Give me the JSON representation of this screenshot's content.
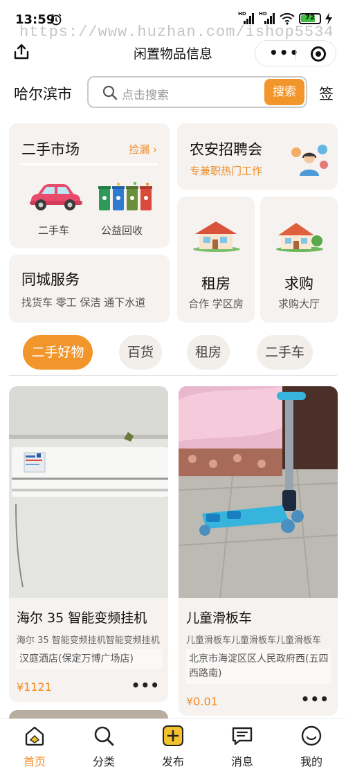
{
  "status_bar": {
    "time": "13:59",
    "battery": "72",
    "icons": [
      "alarm-icon",
      "signal-icon",
      "signal-icon",
      "wifi-icon",
      "battery-icon",
      "charging-icon"
    ]
  },
  "watermark": "https://www.huzhan.com/ishop5534",
  "nav": {
    "title": "闲置物品信息",
    "more_label": "•••"
  },
  "search": {
    "city": "哈尔滨市",
    "placeholder": "点击搜索",
    "button": "搜索",
    "sign": "签"
  },
  "cards": {
    "market": {
      "title": "二手市场",
      "link": "捡漏",
      "items": [
        "二手车",
        "公益回收"
      ]
    },
    "job": {
      "title": "农安招聘会",
      "subtitle": "专兼职热门工作"
    },
    "city_service": {
      "title": "同城服务",
      "subtitle": "找货车 零工 保洁 通下水道"
    },
    "rent": {
      "title": "租房",
      "subtitle": "合作 学区房"
    },
    "buy": {
      "title": "求购",
      "subtitle": "求购大厅"
    }
  },
  "tabs": [
    "二手好物",
    "百货",
    "租房",
    "二手车"
  ],
  "products": [
    {
      "name": "海尔 35 智能变频挂机",
      "desc": "海尔 35 智能变频挂机智能变频挂机",
      "address": "汉庭酒店(保定万博广场店)",
      "price": "¥1121",
      "more": "•••"
    },
    {
      "name": "儿童滑板车",
      "desc": "儿童滑板车儿童滑板车儿童滑板车",
      "address": "北京市海淀区区人民政府西(五四西路南)",
      "price": "¥0.01",
      "more": "•••"
    }
  ],
  "tabbar": [
    "首页",
    "分类",
    "发布",
    "消息",
    "我的"
  ],
  "colors": {
    "accent": "#f2962b",
    "card_bg": "#f5f2ef"
  }
}
